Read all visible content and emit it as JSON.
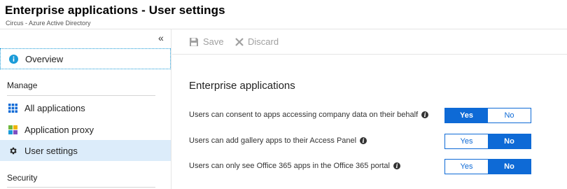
{
  "header": {
    "title": "Enterprise applications - User settings",
    "subtitle": "Circus - Azure Active Directory"
  },
  "sidebar": {
    "collapse_glyph": "«",
    "overview": {
      "label": "Overview",
      "icon": "info-icon"
    },
    "sections": [
      {
        "label": "Manage"
      },
      {
        "label": "Security"
      }
    ],
    "items": [
      {
        "label": "All applications",
        "icon": "grid-icon"
      },
      {
        "label": "Application proxy",
        "icon": "app-proxy-icon"
      },
      {
        "label": "User settings",
        "icon": "gear-icon",
        "selected": true
      }
    ]
  },
  "toolbar": {
    "save_label": "Save",
    "discard_label": "Discard"
  },
  "main": {
    "title": "Enterprise applications",
    "settings": [
      {
        "label": "Users can consent to apps accessing company data on their behalf",
        "yes": "Yes",
        "no": "No",
        "selected": "Yes"
      },
      {
        "label": "Users can add gallery apps to their Access Panel",
        "yes": "Yes",
        "no": "No",
        "selected": "No"
      },
      {
        "label": "Users can only see Office 365 apps in the Office 365 portal",
        "yes": "Yes",
        "no": "No",
        "selected": "No"
      }
    ]
  },
  "colors": {
    "accent": "#0e6ad6",
    "selected_bg": "#dcecfa",
    "info_icon": "#1b9bd8"
  }
}
